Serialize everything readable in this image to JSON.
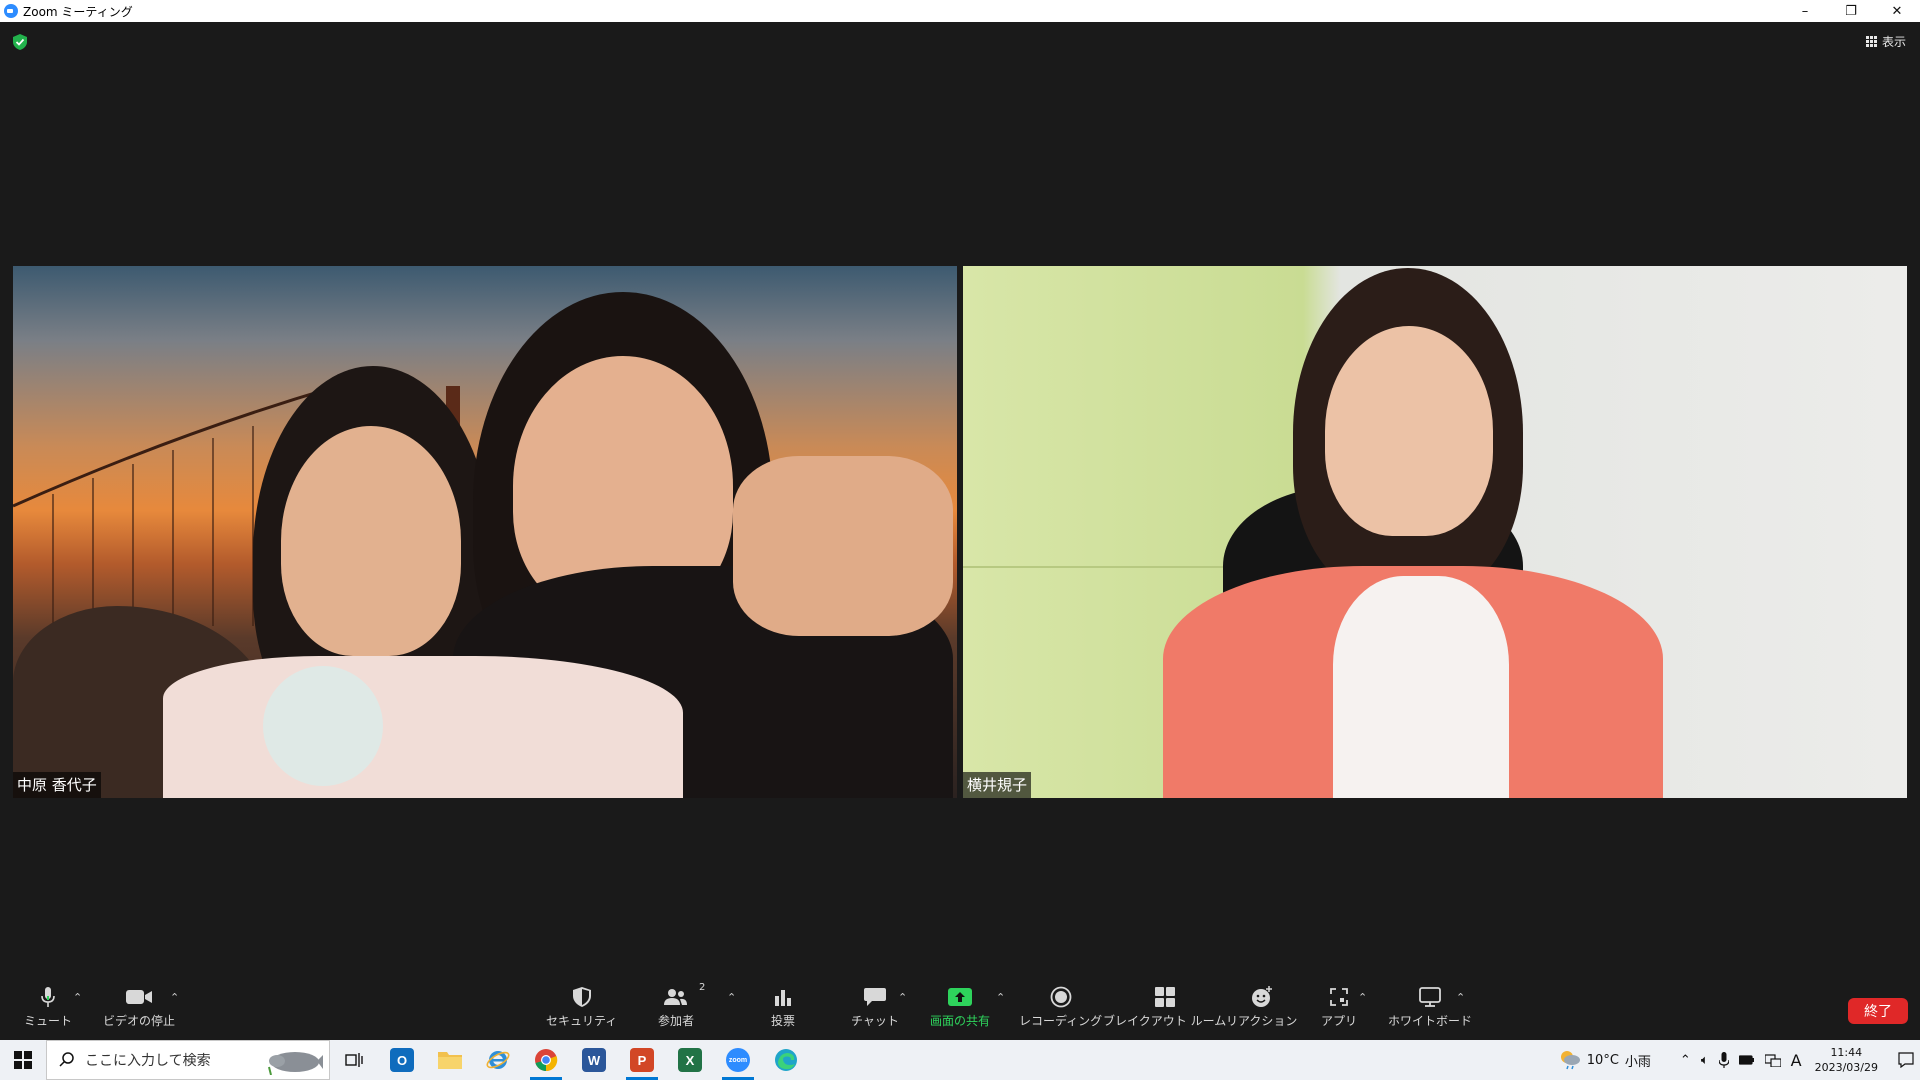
{
  "window": {
    "title": "Zoom ミーティング",
    "minimize": "–",
    "restore": "❐",
    "close": "✕"
  },
  "meeting": {
    "view_label": "表示",
    "participants": [
      {
        "name": "中原 香代子"
      },
      {
        "name": "横井規子"
      }
    ]
  },
  "toolbar": {
    "mute": {
      "label": "ミュート",
      "icon": "microphone-icon"
    },
    "video": {
      "label": "ビデオの停止",
      "icon": "video-camera-icon"
    },
    "security": {
      "label": "セキュリティ",
      "icon": "shield-icon"
    },
    "participants": {
      "label": "参加者",
      "count": "2",
      "icon": "participants-icon"
    },
    "polls": {
      "label": "投票",
      "icon": "bar-chart-icon"
    },
    "chat": {
      "label": "チャット",
      "icon": "chat-bubble-icon"
    },
    "share": {
      "label": "画面の共有",
      "icon": "share-screen-icon",
      "color": "#2ed35c"
    },
    "record": {
      "label": "レコーディング",
      "icon": "record-icon"
    },
    "breakout": {
      "label": "ブレイクアウト ルーム",
      "icon": "grid-icon"
    },
    "reactions": {
      "label": "リアクション",
      "icon": "emoji-icon"
    },
    "apps": {
      "label": "アプリ",
      "icon": "apps-icon"
    },
    "whiteboard": {
      "label": "ホワイトボード",
      "icon": "whiteboard-icon"
    },
    "end": {
      "label": "終了",
      "color": "#e02828"
    }
  },
  "taskbar": {
    "search_placeholder": "ここに入力して検索",
    "apps": [
      "task-view",
      "outlook",
      "file-explorer",
      "internet-explorer",
      "chrome",
      "word",
      "powerpoint",
      "excel",
      "zoom",
      "edge"
    ],
    "weather": {
      "temp": "10°C",
      "condition": "小雨"
    },
    "ime": "A",
    "time": "11:44",
    "date": "2023/03/29"
  }
}
